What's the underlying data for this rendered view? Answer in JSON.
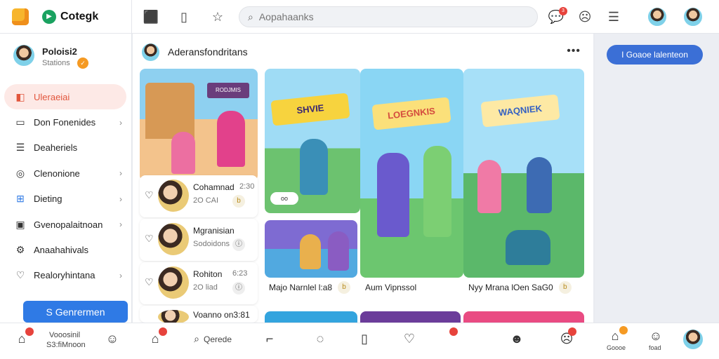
{
  "header": {
    "brand": "Cotegk",
    "search_placeholder": "Aopahaanks",
    "notifications_count": "3"
  },
  "sidebar": {
    "profile": {
      "name": "Poloisi2",
      "subtitle": "Stations"
    },
    "items": [
      {
        "label": "Uleraeiai",
        "icon": "home-icon",
        "active": true
      },
      {
        "label": "Don Fonenides",
        "icon": "folder-icon",
        "chevron": true
      },
      {
        "label": "Deaheriels",
        "icon": "list-icon"
      },
      {
        "label": "Clenonione",
        "icon": "globe-icon",
        "chevron": true
      },
      {
        "label": "Dieting",
        "icon": "gift-icon",
        "chevron": true
      },
      {
        "label": "Gvenopalaitnoan",
        "icon": "bookmark-icon",
        "chevron": true
      },
      {
        "label": "Anaahahivals",
        "icon": "gear-icon"
      },
      {
        "label": "Realoryhintana",
        "icon": "help-icon",
        "chevron": true
      }
    ],
    "generate_label": "S Genrermen"
  },
  "main": {
    "title": "Aderansfondritans",
    "hero_sign": "RODJMIS",
    "list": [
      {
        "title": "Cohamnad",
        "meta": "2:30",
        "sub": "2O CAI"
      },
      {
        "title": "Mgranisian",
        "sub": "Sodoidons"
      },
      {
        "title": "Rohiton",
        "meta": "6:23",
        "sub": "2O liad"
      },
      {
        "title": "Voanno on3:81"
      }
    ],
    "cards": [
      {
        "title": "SHVIE",
        "pill": "oo"
      },
      {
        "title": "LOEGNKIS"
      },
      {
        "title": "WAQNIEK"
      }
    ],
    "captions": [
      "Majo Narnlel l:a8",
      "Aum Vipnssol",
      "Nyy Mrana lOen SaG0"
    ]
  },
  "right": {
    "create_label": "I Goaoe lalenteon"
  },
  "bottom": {
    "left_label_1": "Vooosinil",
    "left_label_2": "S3:fiMnoon",
    "search_label": "Qerede",
    "right_label_1": "Goooe",
    "right_label_2": "foad"
  }
}
